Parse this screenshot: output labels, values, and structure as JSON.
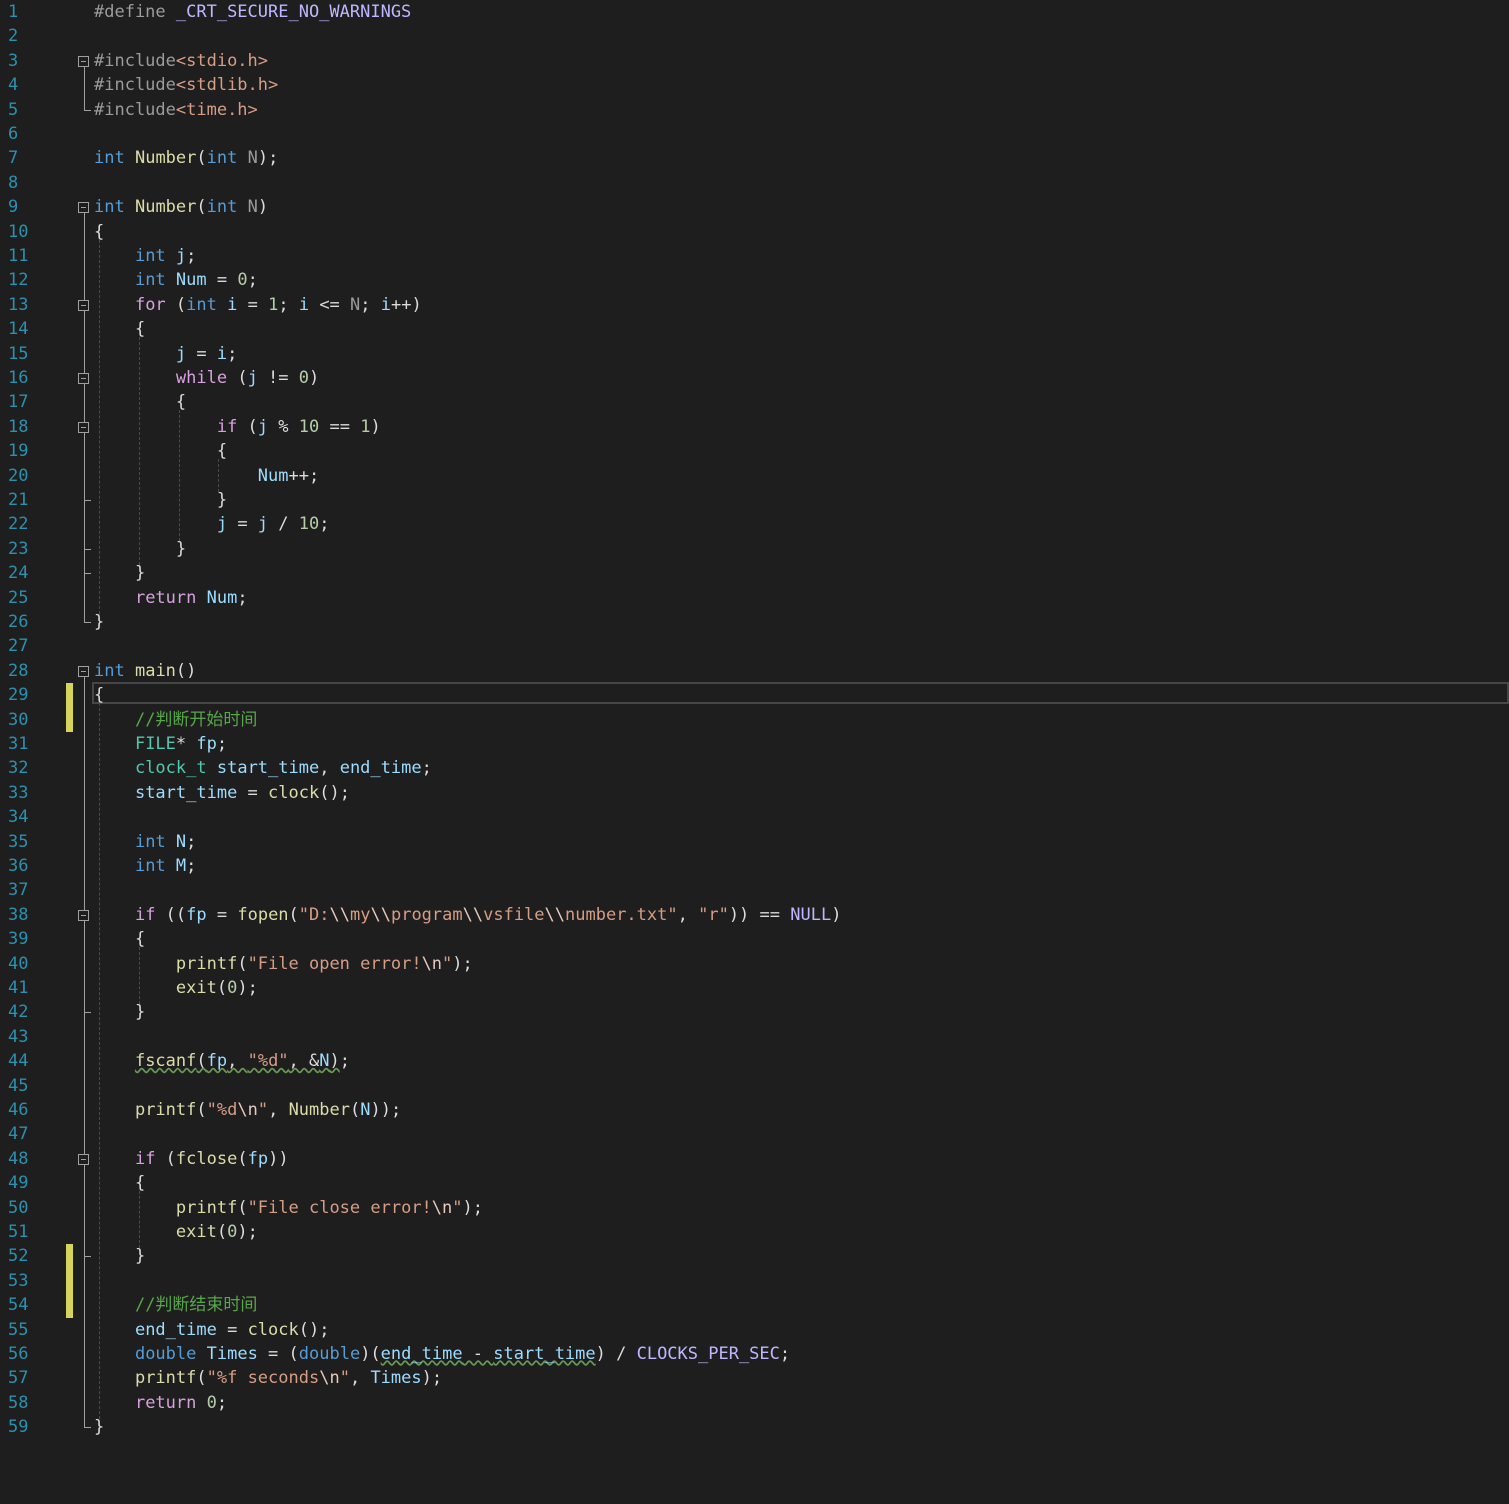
{
  "editor": {
    "language": "C",
    "modified_lines": [
      29,
      30,
      52,
      53,
      54
    ],
    "current_line": 29,
    "lines": [
      [
        {
          "t": "#define ",
          "c": "pp"
        },
        {
          "t": "_CRT_SECURE_NO_WARNINGS",
          "c": "mac2"
        }
      ],
      [],
      [
        {
          "t": "#include",
          "c": "pp"
        },
        {
          "t": "<stdio.h>",
          "c": "inc"
        }
      ],
      [
        {
          "t": "#include",
          "c": "pp"
        },
        {
          "t": "<stdlib.h>",
          "c": "inc"
        }
      ],
      [
        {
          "t": "#include",
          "c": "pp"
        },
        {
          "t": "<time.h>",
          "c": "inc"
        }
      ],
      [],
      [
        {
          "t": "int",
          "c": "kw"
        },
        {
          "t": " "
        },
        {
          "t": "Number",
          "c": "fn"
        },
        {
          "t": "("
        },
        {
          "t": "int",
          "c": "kw"
        },
        {
          "t": " "
        },
        {
          "t": "N",
          "c": "param"
        },
        {
          "t": ");"
        }
      ],
      [],
      [
        {
          "t": "int",
          "c": "kw"
        },
        {
          "t": " "
        },
        {
          "t": "Number",
          "c": "fn"
        },
        {
          "t": "("
        },
        {
          "t": "int",
          "c": "kw"
        },
        {
          "t": " "
        },
        {
          "t": "N",
          "c": "param"
        },
        {
          "t": ")"
        }
      ],
      [
        {
          "t": "{"
        }
      ],
      [
        {
          "t": "    "
        },
        {
          "t": "int",
          "c": "kw"
        },
        {
          "t": " "
        },
        {
          "t": "j",
          "c": "var"
        },
        {
          "t": ";"
        }
      ],
      [
        {
          "t": "    "
        },
        {
          "t": "int",
          "c": "kw"
        },
        {
          "t": " "
        },
        {
          "t": "Num",
          "c": "var"
        },
        {
          "t": " = "
        },
        {
          "t": "0",
          "c": "num"
        },
        {
          "t": ";"
        }
      ],
      [
        {
          "t": "    "
        },
        {
          "t": "for",
          "c": "ctl"
        },
        {
          "t": " ("
        },
        {
          "t": "int",
          "c": "kw"
        },
        {
          "t": " "
        },
        {
          "t": "i",
          "c": "var"
        },
        {
          "t": " = "
        },
        {
          "t": "1",
          "c": "num"
        },
        {
          "t": "; "
        },
        {
          "t": "i",
          "c": "var"
        },
        {
          "t": " <= "
        },
        {
          "t": "N",
          "c": "param"
        },
        {
          "t": "; "
        },
        {
          "t": "i",
          "c": "var"
        },
        {
          "t": "++)"
        }
      ],
      [
        {
          "t": "    {"
        }
      ],
      [
        {
          "t": "        "
        },
        {
          "t": "j",
          "c": "var"
        },
        {
          "t": " = "
        },
        {
          "t": "i",
          "c": "var"
        },
        {
          "t": ";"
        }
      ],
      [
        {
          "t": "        "
        },
        {
          "t": "while",
          "c": "ctl"
        },
        {
          "t": " ("
        },
        {
          "t": "j",
          "c": "var"
        },
        {
          "t": " != "
        },
        {
          "t": "0",
          "c": "num"
        },
        {
          "t": ")"
        }
      ],
      [
        {
          "t": "        {"
        }
      ],
      [
        {
          "t": "            "
        },
        {
          "t": "if",
          "c": "ctl"
        },
        {
          "t": " ("
        },
        {
          "t": "j",
          "c": "var"
        },
        {
          "t": " % "
        },
        {
          "t": "10",
          "c": "num"
        },
        {
          "t": " == "
        },
        {
          "t": "1",
          "c": "num"
        },
        {
          "t": ")"
        }
      ],
      [
        {
          "t": "            {"
        }
      ],
      [
        {
          "t": "                "
        },
        {
          "t": "Num",
          "c": "var"
        },
        {
          "t": "++;"
        }
      ],
      [
        {
          "t": "            }"
        }
      ],
      [
        {
          "t": "            "
        },
        {
          "t": "j",
          "c": "var"
        },
        {
          "t": " = "
        },
        {
          "t": "j",
          "c": "var"
        },
        {
          "t": " / "
        },
        {
          "t": "10",
          "c": "num"
        },
        {
          "t": ";"
        }
      ],
      [
        {
          "t": "        }"
        }
      ],
      [
        {
          "t": "    }"
        }
      ],
      [
        {
          "t": "    "
        },
        {
          "t": "return",
          "c": "ctl"
        },
        {
          "t": " "
        },
        {
          "t": "Num",
          "c": "var"
        },
        {
          "t": ";"
        }
      ],
      [
        {
          "t": "}"
        }
      ],
      [],
      [
        {
          "t": "int",
          "c": "kw"
        },
        {
          "t": " "
        },
        {
          "t": "main",
          "c": "fn"
        },
        {
          "t": "()"
        }
      ],
      [
        {
          "t": "{"
        }
      ],
      [
        {
          "t": "    "
        },
        {
          "t": "//判断开始时间",
          "c": "cm"
        }
      ],
      [
        {
          "t": "    "
        },
        {
          "t": "FILE",
          "c": "ty"
        },
        {
          "t": "* "
        },
        {
          "t": "fp",
          "c": "var"
        },
        {
          "t": ";"
        }
      ],
      [
        {
          "t": "    "
        },
        {
          "t": "clock_t",
          "c": "ty"
        },
        {
          "t": " "
        },
        {
          "t": "start_time",
          "c": "var"
        },
        {
          "t": ", "
        },
        {
          "t": "end_time",
          "c": "var"
        },
        {
          "t": ";"
        }
      ],
      [
        {
          "t": "    "
        },
        {
          "t": "start_time",
          "c": "var"
        },
        {
          "t": " = "
        },
        {
          "t": "clock",
          "c": "fn"
        },
        {
          "t": "();"
        }
      ],
      [],
      [
        {
          "t": "    "
        },
        {
          "t": "int",
          "c": "kw"
        },
        {
          "t": " "
        },
        {
          "t": "N",
          "c": "var"
        },
        {
          "t": ";"
        }
      ],
      [
        {
          "t": "    "
        },
        {
          "t": "int",
          "c": "kw"
        },
        {
          "t": " "
        },
        {
          "t": "M",
          "c": "var"
        },
        {
          "t": ";"
        }
      ],
      [],
      [
        {
          "t": "    "
        },
        {
          "t": "if",
          "c": "ctl"
        },
        {
          "t": " (("
        },
        {
          "t": "fp",
          "c": "var"
        },
        {
          "t": " = "
        },
        {
          "t": "fopen",
          "c": "fn"
        },
        {
          "t": "("
        },
        {
          "t": "\"D:",
          "c": "str"
        },
        {
          "t": "\\\\",
          "c": "esc"
        },
        {
          "t": "my",
          "c": "str"
        },
        {
          "t": "\\\\",
          "c": "esc"
        },
        {
          "t": "program",
          "c": "str"
        },
        {
          "t": "\\\\",
          "c": "esc"
        },
        {
          "t": "vsfile",
          "c": "str"
        },
        {
          "t": "\\\\",
          "c": "esc"
        },
        {
          "t": "number.txt\"",
          "c": "str"
        },
        {
          "t": ", "
        },
        {
          "t": "\"r\"",
          "c": "str"
        },
        {
          "t": ")) == "
        },
        {
          "t": "NULL",
          "c": "mac2"
        },
        {
          "t": ")"
        }
      ],
      [
        {
          "t": "    {"
        }
      ],
      [
        {
          "t": "        "
        },
        {
          "t": "printf",
          "c": "fn"
        },
        {
          "t": "("
        },
        {
          "t": "\"File open error!",
          "c": "str"
        },
        {
          "t": "\\n",
          "c": "esc"
        },
        {
          "t": "\"",
          "c": "str"
        },
        {
          "t": ");"
        }
      ],
      [
        {
          "t": "        "
        },
        {
          "t": "exit",
          "c": "fn"
        },
        {
          "t": "("
        },
        {
          "t": "0",
          "c": "num"
        },
        {
          "t": ");"
        }
      ],
      [
        {
          "t": "    }"
        }
      ],
      [],
      [
        {
          "t": "    "
        },
        {
          "t": "fscanf",
          "c": "fn sq"
        },
        {
          "t": "(",
          "c": "sq"
        },
        {
          "t": "fp",
          "c": "var sq"
        },
        {
          "t": ", ",
          "c": "sq"
        },
        {
          "t": "\"%d\"",
          "c": "str sq"
        },
        {
          "t": ", &",
          "c": "sq"
        },
        {
          "t": "N",
          "c": "var sq"
        },
        {
          "t": ")",
          "c": "sq"
        },
        {
          "t": ";"
        }
      ],
      [],
      [
        {
          "t": "    "
        },
        {
          "t": "printf",
          "c": "fn"
        },
        {
          "t": "("
        },
        {
          "t": "\"%d",
          "c": "str"
        },
        {
          "t": "\\n",
          "c": "esc"
        },
        {
          "t": "\"",
          "c": "str"
        },
        {
          "t": ", "
        },
        {
          "t": "Number",
          "c": "fn"
        },
        {
          "t": "("
        },
        {
          "t": "N",
          "c": "var"
        },
        {
          "t": "));"
        }
      ],
      [],
      [
        {
          "t": "    "
        },
        {
          "t": "if",
          "c": "ctl"
        },
        {
          "t": " ("
        },
        {
          "t": "fclose",
          "c": "fn"
        },
        {
          "t": "("
        },
        {
          "t": "fp",
          "c": "var"
        },
        {
          "t": "))"
        }
      ],
      [
        {
          "t": "    {"
        }
      ],
      [
        {
          "t": "        "
        },
        {
          "t": "printf",
          "c": "fn"
        },
        {
          "t": "("
        },
        {
          "t": "\"File close error!",
          "c": "str"
        },
        {
          "t": "\\n",
          "c": "esc"
        },
        {
          "t": "\"",
          "c": "str"
        },
        {
          "t": ");"
        }
      ],
      [
        {
          "t": "        "
        },
        {
          "t": "exit",
          "c": "fn"
        },
        {
          "t": "("
        },
        {
          "t": "0",
          "c": "num"
        },
        {
          "t": ");"
        }
      ],
      [
        {
          "t": "    }"
        }
      ],
      [],
      [
        {
          "t": "    "
        },
        {
          "t": "//判断结束时间",
          "c": "cm"
        }
      ],
      [
        {
          "t": "    "
        },
        {
          "t": "end_time",
          "c": "var"
        },
        {
          "t": " = "
        },
        {
          "t": "clock",
          "c": "fn"
        },
        {
          "t": "();"
        }
      ],
      [
        {
          "t": "    "
        },
        {
          "t": "double",
          "c": "kw"
        },
        {
          "t": " "
        },
        {
          "t": "Times",
          "c": "var"
        },
        {
          "t": " = ("
        },
        {
          "t": "double",
          "c": "kw"
        },
        {
          "t": ")("
        },
        {
          "t": "end_time",
          "c": "var sq"
        },
        {
          "t": " - ",
          "c": "sq"
        },
        {
          "t": "start_time",
          "c": "var sq"
        },
        {
          "t": ") / "
        },
        {
          "t": "CLOCKS_PER_SEC",
          "c": "mac2"
        },
        {
          "t": ";"
        }
      ],
      [
        {
          "t": "    "
        },
        {
          "t": "printf",
          "c": "fn"
        },
        {
          "t": "("
        },
        {
          "t": "\"%f seconds",
          "c": "str"
        },
        {
          "t": "\\n",
          "c": "esc"
        },
        {
          "t": "\"",
          "c": "str"
        },
        {
          "t": ", "
        },
        {
          "t": "Times",
          "c": "var"
        },
        {
          "t": ");"
        }
      ],
      [
        {
          "t": "    "
        },
        {
          "t": "return",
          "c": "ctl"
        },
        {
          "t": " "
        },
        {
          "t": "0",
          "c": "num"
        },
        {
          "t": ";"
        }
      ],
      [
        {
          "t": "}"
        }
      ]
    ]
  },
  "colors": {
    "background": "#1e1e1e",
    "line_number": "#2b91af",
    "keyword": "#569cd6",
    "control": "#d8a0df",
    "function": "#dcdcaa",
    "string": "#d69d85",
    "comment": "#57a64a",
    "type": "#4ec9b0",
    "variable": "#9cdcfe",
    "change_marker": "#d7d45c"
  }
}
